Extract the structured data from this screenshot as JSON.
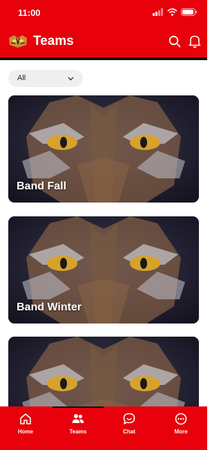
{
  "status": {
    "time": "11:00"
  },
  "header": {
    "title": "Teams"
  },
  "filter": {
    "selected": "All"
  },
  "teams": [
    {
      "name": "Band Fall"
    },
    {
      "name": "Band Winter"
    },
    {
      "name": ""
    }
  ],
  "tabs": [
    {
      "label": "Home",
      "icon": "home-icon"
    },
    {
      "label": "Teams",
      "icon": "teams-icon",
      "active": true
    },
    {
      "label": "Chat",
      "icon": "chat-icon"
    },
    {
      "label": "More",
      "icon": "more-icon"
    }
  ],
  "colors": {
    "brand": "#e8000b",
    "card_bg": "#1e1d2e",
    "eye": "#d8a22a"
  }
}
